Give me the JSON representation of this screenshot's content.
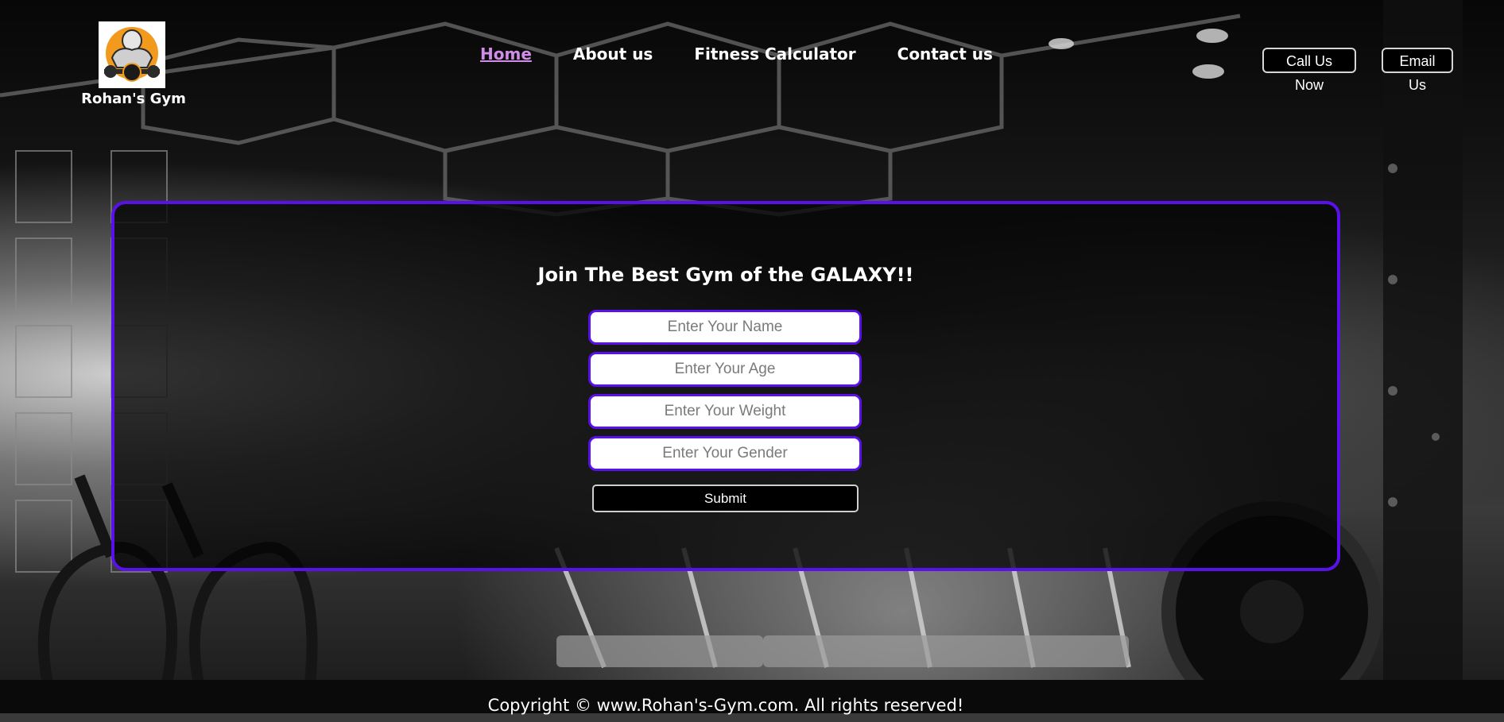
{
  "brand": {
    "name": "Rohan's Gym",
    "logo_colors": {
      "ring": "#f29a1e",
      "figure": "#2b2b2b"
    }
  },
  "nav": {
    "items": [
      {
        "label": "Home",
        "active": true
      },
      {
        "label": "About us",
        "active": false
      },
      {
        "label": "Fitness Calculator",
        "active": false
      },
      {
        "label": "Contact us",
        "active": false
      }
    ]
  },
  "header_buttons": {
    "call": "Call Us Now",
    "email": "Email Us"
  },
  "form": {
    "title": "Join The Best Gym of the GALAXY!!",
    "name_placeholder": "Enter Your Name",
    "age_placeholder": "Enter Your Age",
    "weight_placeholder": "Enter Your Weight",
    "gender_placeholder": "Enter Your Gender",
    "submit_label": "Submit"
  },
  "footer": {
    "copyright": "Copyright © www.Rohan's-Gym.com. All rights reserved!"
  },
  "colors": {
    "accent": "#5a10ea",
    "active_link": "#d08ee8",
    "background": "#000000"
  }
}
